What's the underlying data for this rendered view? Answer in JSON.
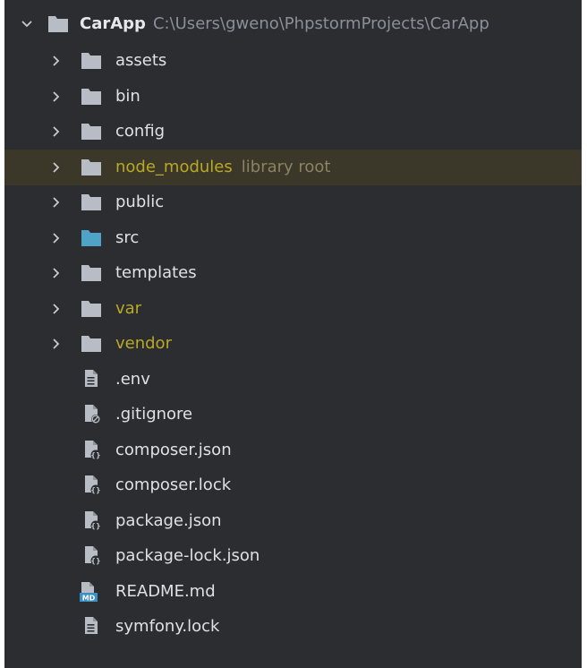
{
  "colors": {
    "panel_bg": "#2b2d30",
    "highlight_bg": "#3b3729",
    "text": "#dfe1e5",
    "folder_gray": "#b8bcc4",
    "folder_blue": "#4fa3c7",
    "excluded_text": "#b9a926",
    "hint_text": "#8a8462",
    "path_text": "#8b8f97"
  },
  "tree": {
    "root": {
      "name": "CarApp",
      "path": "C:\\Users\\gweno\\PhpstormProjects\\CarApp",
      "expanded": true
    },
    "folders": [
      {
        "name": "assets",
        "icon": "folder-icon",
        "style": "normal"
      },
      {
        "name": "bin",
        "icon": "folder-icon",
        "style": "normal"
      },
      {
        "name": "config",
        "icon": "folder-icon",
        "style": "normal"
      },
      {
        "name": "node_modules",
        "icon": "folder-icon",
        "style": "excluded",
        "hint": "library root",
        "highlighted": true
      },
      {
        "name": "public",
        "icon": "folder-icon",
        "style": "normal"
      },
      {
        "name": "src",
        "icon": "source-folder-icon",
        "style": "source"
      },
      {
        "name": "templates",
        "icon": "folder-icon",
        "style": "normal"
      },
      {
        "name": "var",
        "icon": "folder-icon",
        "style": "excluded"
      },
      {
        "name": "vendor",
        "icon": "folder-icon",
        "style": "excluded"
      }
    ],
    "files": [
      {
        "name": ".env",
        "icon": "text-file-icon"
      },
      {
        "name": ".gitignore",
        "icon": "ignore-file-icon"
      },
      {
        "name": "composer.json",
        "icon": "composer-file-icon"
      },
      {
        "name": "composer.lock",
        "icon": "composer-file-icon"
      },
      {
        "name": "package.json",
        "icon": "json-file-icon"
      },
      {
        "name": "package-lock.json",
        "icon": "json-file-icon"
      },
      {
        "name": "README.md",
        "icon": "markdown-file-icon",
        "badge": "MD"
      },
      {
        "name": "symfony.lock",
        "icon": "text-file-icon"
      }
    ]
  }
}
